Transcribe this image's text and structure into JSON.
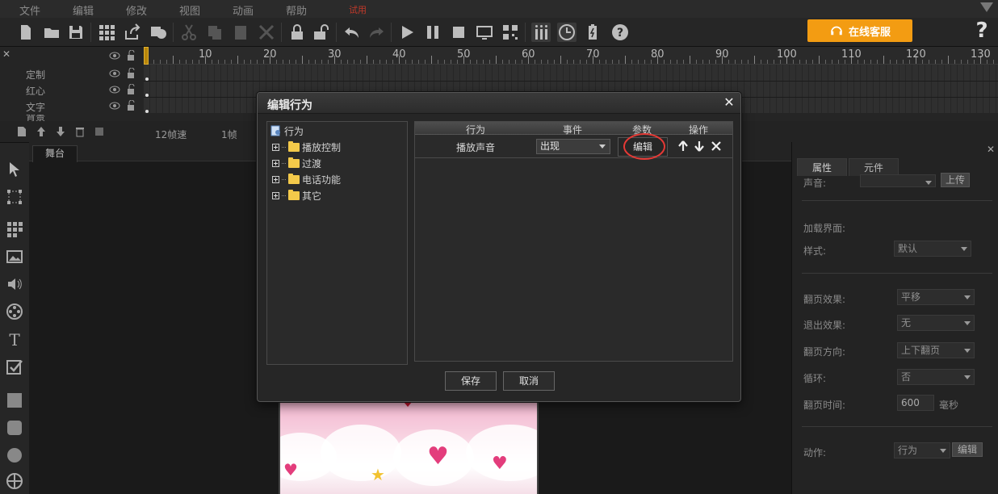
{
  "menu": {
    "items": [
      "文件",
      "编辑",
      "修改",
      "视图",
      "动画",
      "帮助"
    ],
    "extra": "试用"
  },
  "toolbar": {
    "online_service_label": "在线客服",
    "help_glyph": "?"
  },
  "timeline": {
    "ruler_numbers": [
      "10",
      "20",
      "30",
      "40",
      "50",
      "60",
      "70",
      "80",
      "90",
      "100",
      "110",
      "120",
      "130"
    ],
    "layers": [
      "定制",
      "红心",
      "文字",
      "背景"
    ],
    "frame_rate_label": "12帧速",
    "frame_label": "1帧"
  },
  "stage": {
    "tab_label": "舞台"
  },
  "right_panel": {
    "tabs": [
      "属性",
      "元件"
    ],
    "sound_label": "声音:",
    "upload_label": "上传",
    "loading_label": "加载界面:",
    "style_label": "样式:",
    "style_value": "默认",
    "flip_effect_label": "翻页效果:",
    "flip_effect_value": "平移",
    "exit_effect_label": "退出效果:",
    "exit_effect_value": "无",
    "flip_direction_label": "翻页方向:",
    "flip_direction_value": "上下翻页",
    "loop_label": "循环:",
    "loop_value": "否",
    "flip_time_label": "翻页时间:",
    "flip_time_value": "600",
    "flip_time_unit": "毫秒",
    "action_label": "动作:",
    "action_value": "行为",
    "action_edit_label": "编辑"
  },
  "dialog": {
    "title": "编辑行为",
    "tree": {
      "root": "行为",
      "children": [
        "播放控制",
        "过渡",
        "电话功能",
        "其它"
      ]
    },
    "table": {
      "headers": [
        "行为",
        "事件",
        "参数",
        "操作"
      ],
      "rows": [
        {
          "action": "播放声音",
          "event": "出现",
          "param_button": "编辑"
        }
      ]
    },
    "ok_label": "保存",
    "cancel_label": "取消"
  },
  "colors": {
    "accent_orange": "#f39c12",
    "highlight_red": "#e53935",
    "folder_yellow": "#f3c94a"
  }
}
